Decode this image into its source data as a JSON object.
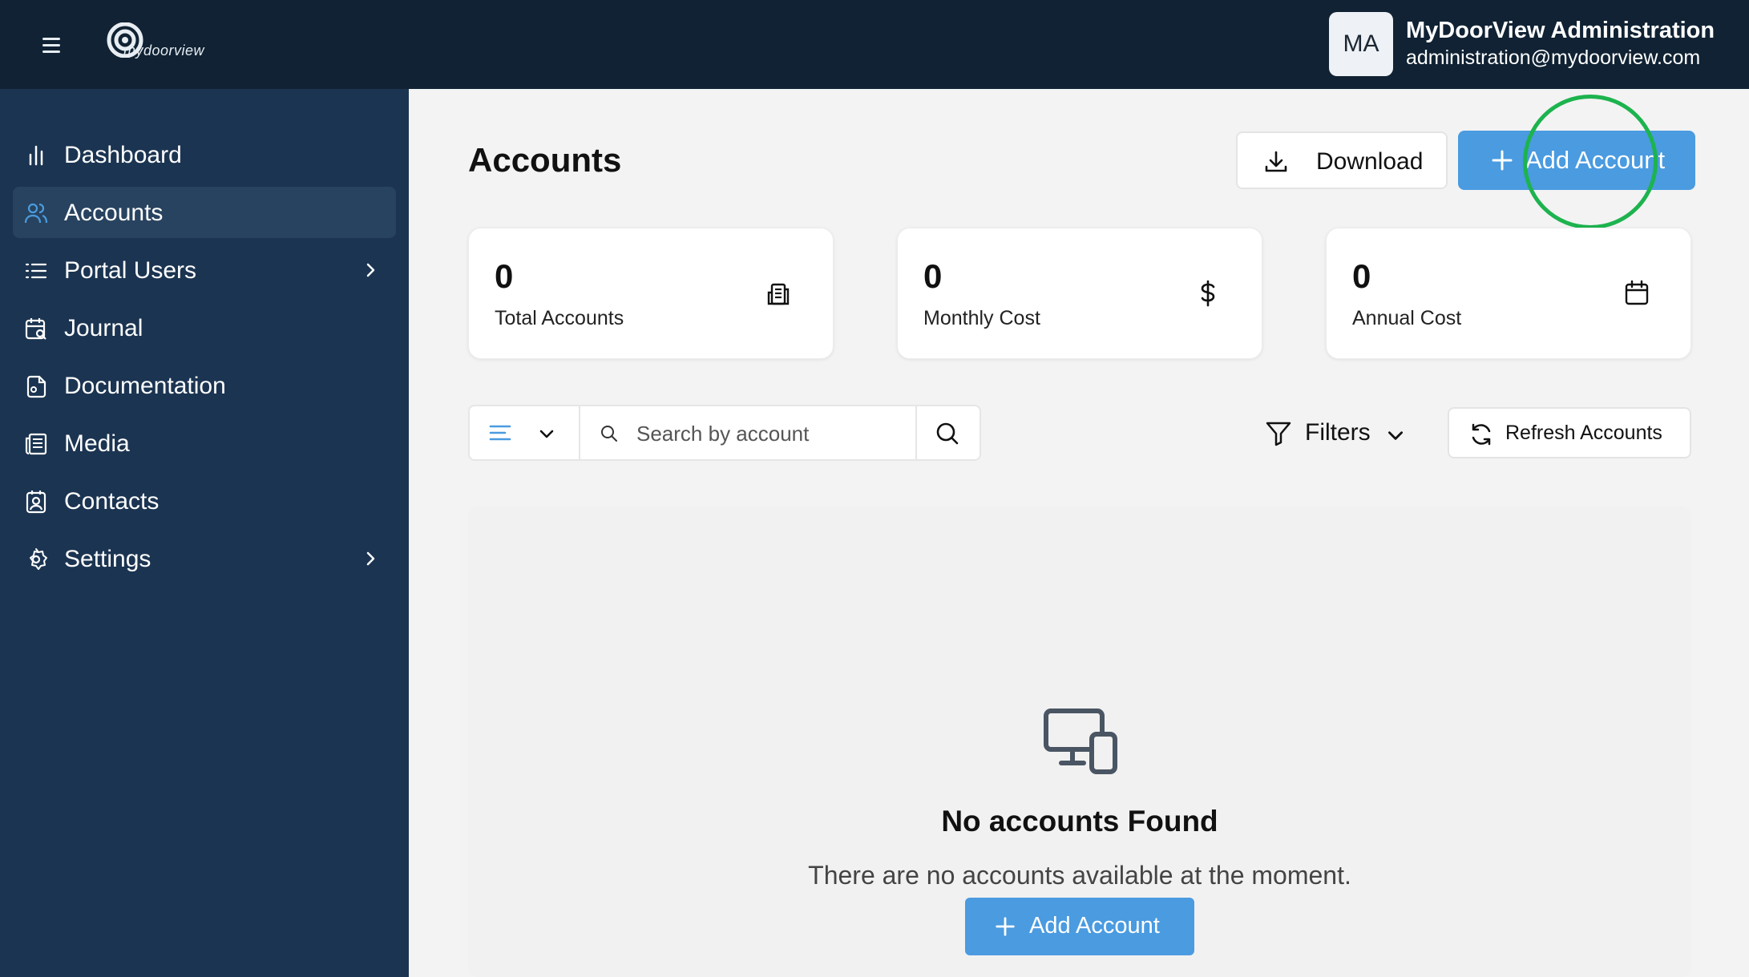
{
  "header": {
    "logo_text": "mydoorview",
    "avatar_initials": "MA",
    "user_name": "MyDoorView Administration",
    "user_email": "administration@mydoorview.com"
  },
  "sidebar": {
    "items": [
      {
        "label": "Dashboard",
        "icon": "bar-chart-icon",
        "active": false,
        "has_chevron": false
      },
      {
        "label": "Accounts",
        "icon": "users-icon",
        "active": true,
        "has_chevron": false
      },
      {
        "label": "Portal Users",
        "icon": "list-icon",
        "active": false,
        "has_chevron": true
      },
      {
        "label": "Journal",
        "icon": "calendar-search-icon",
        "active": false,
        "has_chevron": false
      },
      {
        "label": "Documentation",
        "icon": "document-icon",
        "active": false,
        "has_chevron": false
      },
      {
        "label": "Media",
        "icon": "newspaper-icon",
        "active": false,
        "has_chevron": false
      },
      {
        "label": "Contacts",
        "icon": "contact-card-icon",
        "active": false,
        "has_chevron": false
      },
      {
        "label": "Settings",
        "icon": "gear-icon",
        "active": false,
        "has_chevron": true
      }
    ]
  },
  "main": {
    "title": "Accounts",
    "download_label": "Download",
    "add_account_label": "Add Account",
    "stats": [
      {
        "value": "0",
        "label": "Total Accounts",
        "icon": "building-icon"
      },
      {
        "value": "0",
        "label": "Monthly Cost",
        "icon": "dollar-icon"
      },
      {
        "value": "0",
        "label": "Annual Cost",
        "icon": "calendar-icon"
      }
    ],
    "search_placeholder": "Search by account",
    "search_value": "",
    "filters_label": "Filters",
    "refresh_label": "Refresh Accounts",
    "empty_state": {
      "title": "No accounts Found",
      "description": "There are no accounts available at the moment.",
      "button_label": "Add Account"
    }
  },
  "colors": {
    "topbar": "#102233",
    "sidebar": "#1b3451",
    "sidebar_active": "#28435f",
    "accent": "#4a9be0",
    "highlight_ring": "#1db34e"
  }
}
